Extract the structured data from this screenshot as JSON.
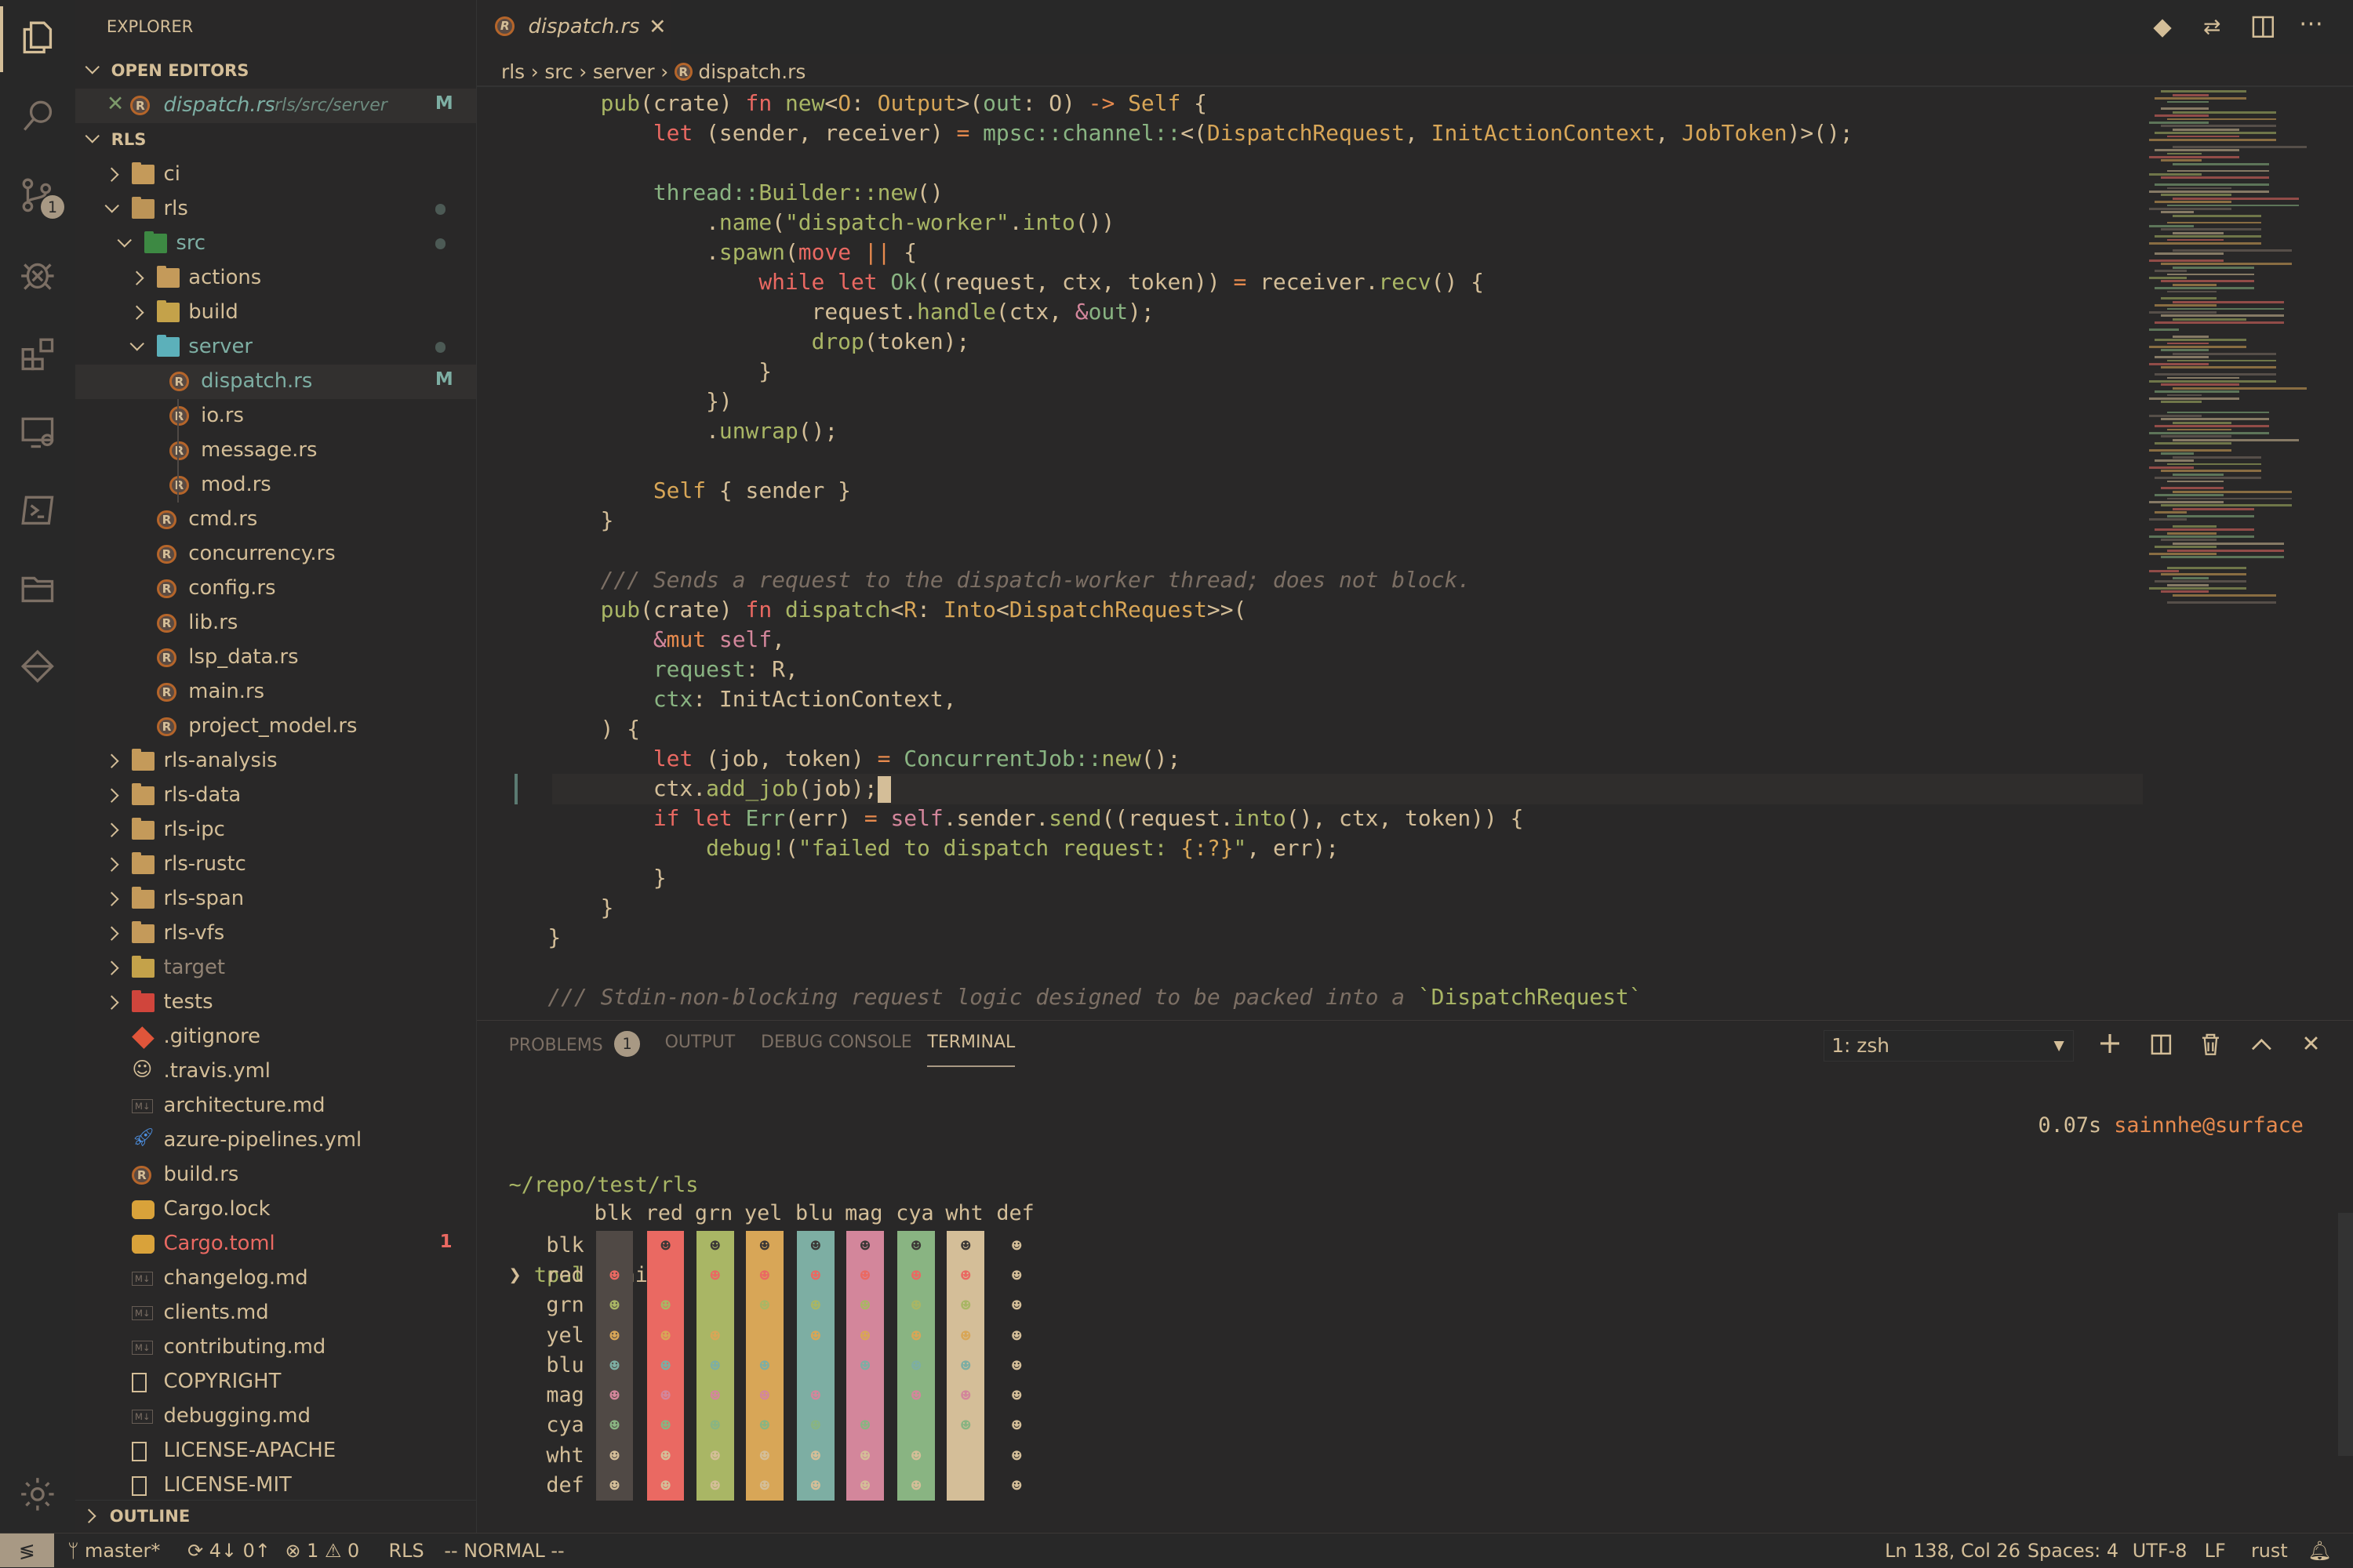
{
  "sidebar": {
    "title": "EXPLORER",
    "open_editors_label": "OPEN EDITORS",
    "open_editor": {
      "name": "dispatch.rs",
      "path": "rls/src/server",
      "status": "M"
    },
    "root_label": "RLS",
    "outline_label": "OUTLINE",
    "items": [
      {
        "label": "ci",
        "type": "folder",
        "depth": 0,
        "open": false
      },
      {
        "label": "rls",
        "type": "folder",
        "depth": 0,
        "open": true,
        "dot": true
      },
      {
        "label": "src",
        "type": "folder-src",
        "depth": 1,
        "open": true,
        "dot": true,
        "modified": true
      },
      {
        "label": "actions",
        "type": "folder",
        "depth": 2,
        "open": false
      },
      {
        "label": "build",
        "type": "folder-build",
        "depth": 2,
        "open": false
      },
      {
        "label": "server",
        "type": "folder-server",
        "depth": 2,
        "open": true,
        "dot": true,
        "modified": true
      },
      {
        "label": "dispatch.rs",
        "type": "rs",
        "depth": 3,
        "status": "M",
        "selected": true,
        "modified": true
      },
      {
        "label": "io.rs",
        "type": "rs",
        "depth": 3
      },
      {
        "label": "message.rs",
        "type": "rs",
        "depth": 3
      },
      {
        "label": "mod.rs",
        "type": "rs",
        "depth": 3
      },
      {
        "label": "cmd.rs",
        "type": "rs",
        "depth": 2
      },
      {
        "label": "concurrency.rs",
        "type": "rs",
        "depth": 2
      },
      {
        "label": "config.rs",
        "type": "rs",
        "depth": 2
      },
      {
        "label": "lib.rs",
        "type": "rs",
        "depth": 2
      },
      {
        "label": "lsp_data.rs",
        "type": "rs",
        "depth": 2
      },
      {
        "label": "main.rs",
        "type": "rs",
        "depth": 2
      },
      {
        "label": "project_model.rs",
        "type": "rs",
        "depth": 2
      },
      {
        "label": "rls-analysis",
        "type": "folder",
        "depth": 0,
        "open": false
      },
      {
        "label": "rls-data",
        "type": "folder",
        "depth": 0,
        "open": false
      },
      {
        "label": "rls-ipc",
        "type": "folder",
        "depth": 0,
        "open": false
      },
      {
        "label": "rls-rustc",
        "type": "folder",
        "depth": 0,
        "open": false
      },
      {
        "label": "rls-span",
        "type": "folder",
        "depth": 0,
        "open": false
      },
      {
        "label": "rls-vfs",
        "type": "folder",
        "depth": 0,
        "open": false
      },
      {
        "label": "target",
        "type": "folder-build",
        "depth": 0,
        "open": false,
        "dim": true
      },
      {
        "label": "tests",
        "type": "folder-tests",
        "depth": 0,
        "open": false
      },
      {
        "label": ".gitignore",
        "type": "git",
        "depth": 0
      },
      {
        "label": ".travis.yml",
        "type": "travis",
        "depth": 0
      },
      {
        "label": "architecture.md",
        "type": "md",
        "depth": 0
      },
      {
        "label": "azure-pipelines.yml",
        "type": "azure",
        "depth": 0
      },
      {
        "label": "build.rs",
        "type": "rs",
        "depth": 0
      },
      {
        "label": "Cargo.lock",
        "type": "cargo",
        "depth": 0
      },
      {
        "label": "Cargo.toml",
        "type": "cargo",
        "depth": 0,
        "status": "1",
        "error": true
      },
      {
        "label": "changelog.md",
        "type": "md",
        "depth": 0
      },
      {
        "label": "clients.md",
        "type": "md",
        "depth": 0
      },
      {
        "label": "contributing.md",
        "type": "md",
        "depth": 0
      },
      {
        "label": "COPYRIGHT",
        "type": "file",
        "depth": 0
      },
      {
        "label": "debugging.md",
        "type": "md",
        "depth": 0
      },
      {
        "label": "LICENSE-APACHE",
        "type": "file",
        "depth": 0
      },
      {
        "label": "LICENSE-MIT",
        "type": "file",
        "depth": 0
      }
    ]
  },
  "activity_bar": {
    "scm_badge": "1"
  },
  "editor": {
    "tab": "dispatch.rs",
    "breadcrumbs": [
      "rls",
      "src",
      "server",
      "dispatch.rs"
    ],
    "code": [
      [
        [
          "n",
          "    "
        ],
        [
          "f",
          "pub"
        ],
        [
          "n",
          "(crate) "
        ],
        [
          "k",
          "fn "
        ],
        [
          "f",
          "new"
        ],
        [
          "n",
          "<"
        ],
        [
          "t",
          "O"
        ],
        [
          "n",
          ": "
        ],
        [
          "t",
          "Output"
        ],
        [
          "n",
          ">("
        ],
        [
          "v",
          "out"
        ],
        [
          "n",
          ": O) "
        ],
        [
          "o",
          "->"
        ],
        [
          "t",
          " Self"
        ],
        [
          "n",
          " {"
        ]
      ],
      [
        [
          "n",
          "        "
        ],
        [
          "k",
          "let"
        ],
        [
          "n",
          " (sender, receiver) "
        ],
        [
          "o",
          "="
        ],
        [
          "v",
          " mpsc::channel::"
        ],
        [
          "n",
          "<("
        ],
        [
          "t",
          "DispatchRequest"
        ],
        [
          "n",
          ", "
        ],
        [
          "t",
          "InitActionContext"
        ],
        [
          "n",
          ", "
        ],
        [
          "t",
          "JobToken"
        ],
        [
          "n",
          ")>();"
        ]
      ],
      [],
      [
        [
          "n",
          "        "
        ],
        [
          "v",
          "thread::"
        ],
        [
          "f",
          "Builder::new"
        ],
        [
          "n",
          "()"
        ]
      ],
      [
        [
          "n",
          "            ."
        ],
        [
          "f",
          "name"
        ],
        [
          "n",
          "("
        ],
        [
          "s",
          "\"dispatch-worker\""
        ],
        [
          "n",
          "."
        ],
        [
          "f",
          "into"
        ],
        [
          "n",
          "())"
        ]
      ],
      [
        [
          "n",
          "            ."
        ],
        [
          "f",
          "spawn"
        ],
        [
          "n",
          "("
        ],
        [
          "k",
          "move"
        ],
        [
          "o",
          " ||"
        ],
        [
          "n",
          " {"
        ]
      ],
      [
        [
          "n",
          "                "
        ],
        [
          "k",
          "while let "
        ],
        [
          "v",
          "Ok"
        ],
        [
          "n",
          "((request, ctx, token)) "
        ],
        [
          "o",
          "="
        ],
        [
          "n",
          " receiver."
        ],
        [
          "f",
          "recv"
        ],
        [
          "n",
          "() {"
        ]
      ],
      [
        [
          "n",
          "                    request."
        ],
        [
          "f",
          "handle"
        ],
        [
          "n",
          "(ctx, "
        ],
        [
          "p",
          "&"
        ],
        [
          "v",
          "out"
        ],
        [
          "n",
          ");"
        ]
      ],
      [
        [
          "n",
          "                    "
        ],
        [
          "f",
          "drop"
        ],
        [
          "n",
          "(token);"
        ]
      ],
      [
        [
          "n",
          "                }"
        ]
      ],
      [
        [
          "n",
          "            })"
        ]
      ],
      [
        [
          "n",
          "            ."
        ],
        [
          "f",
          "unwrap"
        ],
        [
          "n",
          "();"
        ]
      ],
      [],
      [
        [
          "n",
          "        "
        ],
        [
          "t",
          "Self"
        ],
        [
          "n",
          " { sender }"
        ]
      ],
      [
        [
          "n",
          "    }"
        ]
      ],
      [],
      [
        [
          "n",
          "    "
        ],
        [
          "c",
          "/// Sends a request to the dispatch-worker thread; does not block."
        ]
      ],
      [
        [
          "n",
          "    "
        ],
        [
          "f",
          "pub"
        ],
        [
          "n",
          "(crate) "
        ],
        [
          "k",
          "fn "
        ],
        [
          "f",
          "dispatch"
        ],
        [
          "n",
          "<"
        ],
        [
          "t",
          "R"
        ],
        [
          "n",
          ": "
        ],
        [
          "t",
          "Into"
        ],
        [
          "n",
          "<"
        ],
        [
          "t",
          "DispatchRequest"
        ],
        [
          "n",
          ">>("
        ]
      ],
      [
        [
          "n",
          "        "
        ],
        [
          "p",
          "&"
        ],
        [
          "o",
          "mut "
        ],
        [
          "p",
          "self"
        ],
        [
          "n",
          ","
        ]
      ],
      [
        [
          "n",
          "        "
        ],
        [
          "v",
          "request"
        ],
        [
          "n",
          ": R,"
        ]
      ],
      [
        [
          "n",
          "        "
        ],
        [
          "v",
          "ctx"
        ],
        [
          "n",
          ": InitActionContext,"
        ]
      ],
      [
        [
          "n",
          "    ) {"
        ]
      ],
      [
        [
          "n",
          "        "
        ],
        [
          "k",
          "let"
        ],
        [
          "n",
          " (job, token) "
        ],
        [
          "o",
          "="
        ],
        [
          "v",
          " ConcurrentJob::"
        ],
        [
          "f",
          "new"
        ],
        [
          "n",
          "();"
        ]
      ],
      [
        [
          "n",
          "        ctx."
        ],
        [
          "f",
          "add_job"
        ],
        [
          "n",
          "(job);"
        ]
      ],
      [
        [
          "n",
          "        "
        ],
        [
          "k",
          "if let "
        ],
        [
          "v",
          "Err"
        ],
        [
          "n",
          "(err) "
        ],
        [
          "o",
          "="
        ],
        [
          "p",
          " self"
        ],
        [
          "n",
          ".sender."
        ],
        [
          "f",
          "send"
        ],
        [
          "n",
          "((request."
        ],
        [
          "f",
          "into"
        ],
        [
          "n",
          "(), ctx, token)) {"
        ]
      ],
      [
        [
          "n",
          "            "
        ],
        [
          "f",
          "debug!"
        ],
        [
          "n",
          "("
        ],
        [
          "s",
          "\"failed to dispatch request: "
        ],
        [
          "t",
          "{:?}"
        ],
        [
          "s",
          "\""
        ],
        [
          "n",
          ", err);"
        ]
      ],
      [
        [
          "n",
          "        }"
        ]
      ],
      [
        [
          "n",
          "    }"
        ]
      ],
      [
        [
          "n",
          "}"
        ]
      ],
      [],
      [
        [
          "c",
          "/// Stdin-non-blocking request logic designed to be packed into a "
        ],
        [
          "s",
          "`DispatchRequest`"
        ]
      ]
    ]
  },
  "panel": {
    "tabs": [
      {
        "label": "PROBLEMS",
        "badge": "1"
      },
      {
        "label": "OUTPUT"
      },
      {
        "label": "DEBUG CONSOLE"
      },
      {
        "label": "TERMINAL",
        "active": true
      }
    ],
    "terminal_select": "1: zsh",
    "terminal": {
      "cwd": "~/repo/test/rls",
      "prompt": "❯",
      "command": "tpal",
      "argument": "minimat",
      "right_info_time": "0.07s",
      "right_info_host": "sainnhe@surface",
      "columns": [
        "blk",
        "red",
        "grn",
        "yel",
        "blu",
        "mag",
        "cya",
        "wht",
        "def"
      ],
      "rows": [
        "blk",
        "red",
        "grn",
        "yel",
        "blu",
        "mag",
        "cya",
        "wht",
        "def"
      ],
      "glyph": "☻",
      "palette": {
        "blk": "#504945",
        "red": "#ea6962",
        "grn": "#a9b665",
        "yel": "#d8a657",
        "blu": "#7daea3",
        "mag": "#d3869b",
        "cya": "#89b482",
        "wht": "#d4be98"
      }
    }
  },
  "statusbar": {
    "branch": "master*",
    "sync": "4↓ 0↑",
    "errors": "1",
    "warnings": "0",
    "language_server": "RLS",
    "mode": "-- NORMAL --",
    "position": "Ln 138, Col 26",
    "spaces": "Spaces: 4",
    "encoding": "UTF-8",
    "eol": "LF",
    "language": "rust"
  },
  "colors": {
    "background": "#292828",
    "foreground": "#d4be98",
    "red": "#ea6962",
    "green": "#a9b665",
    "yellow": "#d8a657",
    "aqua": "#89b482",
    "orange": "#e78a4e",
    "purple": "#d3869b",
    "comment": "#7c6f64"
  }
}
